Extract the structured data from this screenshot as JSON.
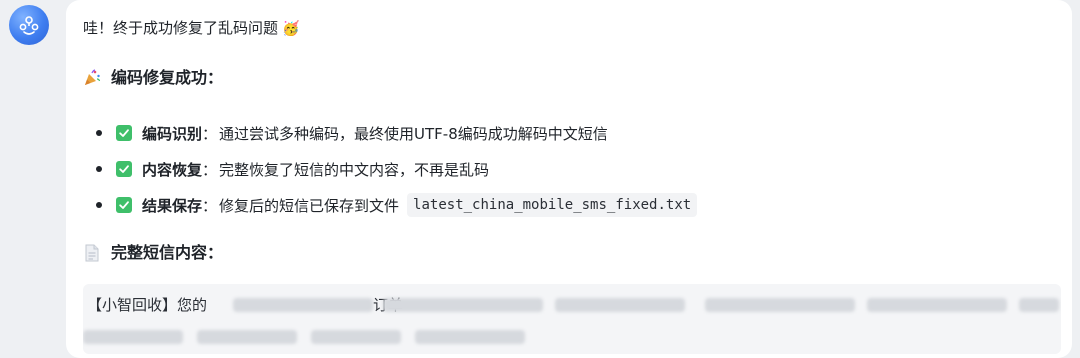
{
  "chat": {
    "greeting": "哇！终于成功修复了乱码问题",
    "greeting_emoji": "🥳",
    "section1": {
      "icon": "party-popper-icon",
      "title": "编码修复成功："
    },
    "items": [
      {
        "icon": "check-box-icon",
        "label": "编码识别",
        "colon": "：",
        "text": "通过尝试多种编码，最终使用UTF-8编码成功解码中文短信"
      },
      {
        "icon": "check-box-icon",
        "label": "内容恢复",
        "colon": "：",
        "text": "完整恢复了短信的中文内容，不再是乱码"
      },
      {
        "icon": "check-box-icon",
        "label": "结果保存",
        "colon": "：",
        "text": "修复后的短信已保存到文件",
        "code": "latest_china_mobile_sms_fixed.txt"
      }
    ],
    "section2": {
      "icon": "document-icon",
      "title": "完整短信内容："
    },
    "sms": {
      "prefix": "【小智回收】您的",
      "fragment": "订单"
    },
    "colors": {
      "page_bg": "#eef0f3",
      "bubble_bg": "#ffffff",
      "check_green": "#3fbf6a",
      "avatar_blue": "#3f7ef0",
      "sms_box_bg": "#f4f5f7"
    }
  }
}
